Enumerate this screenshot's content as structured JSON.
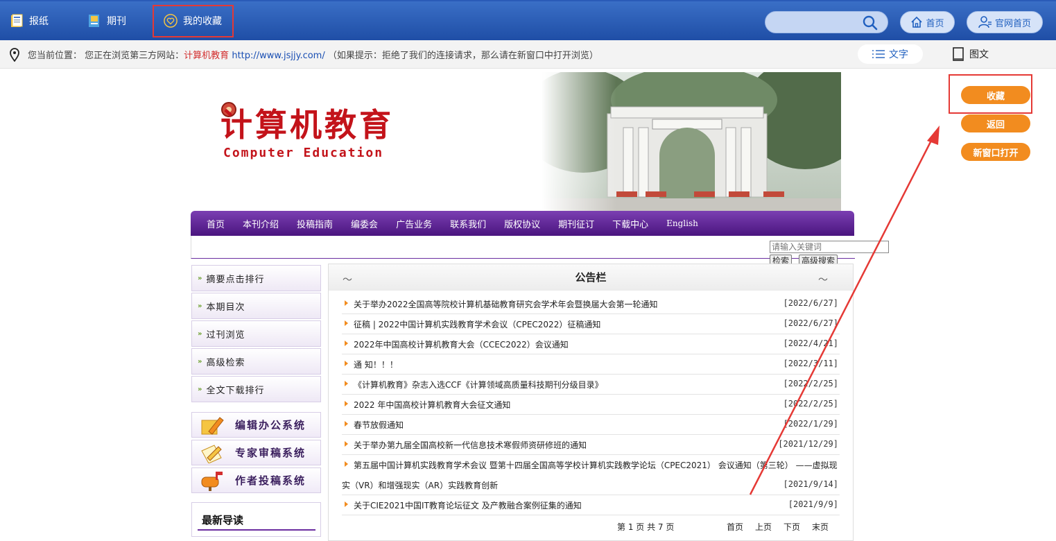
{
  "topnav": {
    "newspaper": "报纸",
    "journal": "期刊",
    "favorites": "我的收藏",
    "home": "首页",
    "official_home": "官网首页"
  },
  "location": {
    "label": "您当前位置：",
    "browsing": "您正在浏览第三方网站：",
    "site_name": "计算机教育",
    "site_url": "http://www.jsjjy.com/",
    "hint": "（如果提示：拒绝了我们的连接请求，那么请在新窗口中打开浏览）",
    "mode_text": "文字",
    "mode_pic": "图文"
  },
  "side_buttons": {
    "collect": "收藏",
    "back": "返回",
    "new_window": "新窗口打开"
  },
  "banner": {
    "logo_cn": "计算机教育",
    "logo_en": "Computer Education"
  },
  "sitenav": [
    "首页",
    "本刊介绍",
    "投稿指南",
    "编委会",
    "广告业务",
    "联系我们",
    "版权协议",
    "期刊征订",
    "下载中心",
    "English"
  ],
  "search": {
    "placeholder": "请输入关键词",
    "search_btn": "检索",
    "adv_btn": "高级搜索"
  },
  "sidebar": [
    "摘要点击排行",
    "本期目次",
    "过刊浏览",
    "高级检索",
    "全文下载排行"
  ],
  "systems": [
    "编辑办公系统",
    "专家审稿系统",
    "作者投稿系统"
  ],
  "guide_title": "最新导读",
  "board": {
    "title": "公告栏",
    "notices": [
      {
        "title": "关于举办2022全国高等院校计算机基础教育研究会学术年会暨换届大会第一轮通知",
        "date": "[2022/6/27]"
      },
      {
        "title": "征稿 | 2022中国计算机实践教育学术会议（CPEC2022）征稿通知",
        "date": "[2022/6/27]"
      },
      {
        "title": "2022年中国高校计算机教育大会（CCEC2022）会议通知",
        "date": "[2022/4/21]"
      },
      {
        "title": "通 知！！！",
        "date": "[2022/3/11]"
      },
      {
        "title": "《计算机教育》杂志入选CCF《计算领域高质量科技期刊分级目录》",
        "date": "[2022/2/25]"
      },
      {
        "title": "2022 年中国高校计算机教育大会征文通知",
        "date": "[2022/2/25]"
      },
      {
        "title": "春节放假通知",
        "date": "[2022/1/29]"
      },
      {
        "title": "关于举办第九届全国高校新一代信息技术寒假师资研修班的通知",
        "date": "[2021/12/29]"
      },
      {
        "title": "第五届中国计算机实践教育学术会议 暨第十四届全国高等学校计算机实践教学论坛（CPEC2021） 会议通知（第三轮） ——虚拟现",
        "title2": "实（VR）和增强现实（AR）实践教育创新",
        "date": "[2021/9/14]"
      },
      {
        "title": "关于CIE2021中国IT教育论坛征文 及产教融合案例征集的通知",
        "date": "[2021/9/9]"
      }
    ],
    "pager": {
      "info": "第 1 页 共 7 页",
      "first": "首页",
      "prev": "上页",
      "next": "下页",
      "last": "末页"
    }
  },
  "colors": {
    "topbar": "#2a5bb8",
    "accent_orange": "#f28c1f",
    "nav_purple": "#5a1f92",
    "annotation_red": "#e53935"
  }
}
